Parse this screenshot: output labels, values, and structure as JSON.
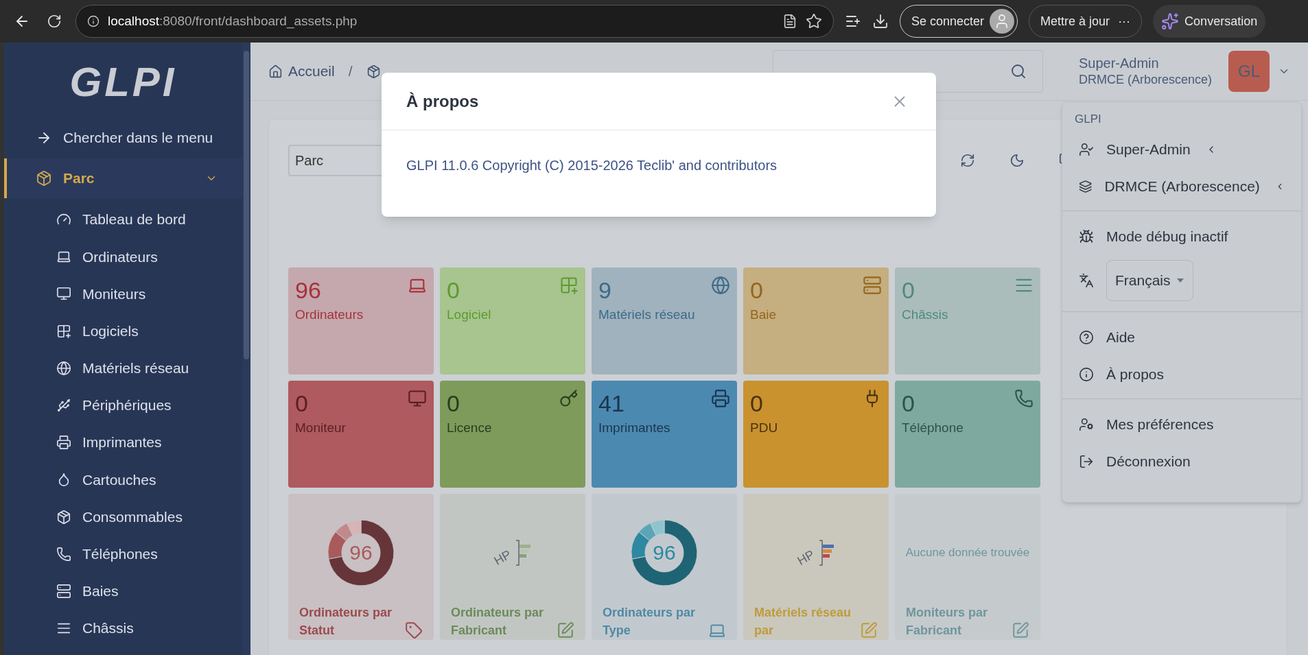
{
  "browser": {
    "url_host": "localhost",
    "url_rest": ":8080/front/dashboard_assets.php",
    "sign_in": "Se connecter",
    "update": "Mettre à jour",
    "more": "···",
    "copilot": "Conversation"
  },
  "sidebar": {
    "logo": "GLPI",
    "search_menu": "Chercher dans le menu",
    "section": {
      "label": "Parc",
      "expanded": true
    },
    "items": [
      {
        "label": "Tableau de bord"
      },
      {
        "label": "Ordinateurs"
      },
      {
        "label": "Moniteurs"
      },
      {
        "label": "Logiciels"
      },
      {
        "label": "Matériels réseau"
      },
      {
        "label": "Périphériques"
      },
      {
        "label": "Imprimantes"
      },
      {
        "label": "Cartouches"
      },
      {
        "label": "Consommables"
      },
      {
        "label": "Téléphones"
      },
      {
        "label": "Baies"
      },
      {
        "label": "Châssis"
      }
    ]
  },
  "header": {
    "breadcrumb": [
      {
        "label": "Accueil"
      },
      {
        "kind": "section"
      }
    ],
    "separator": "/",
    "user": {
      "name": "Super-Admin",
      "entity": "DRMCE (Arborescence)",
      "avatar": "GL"
    }
  },
  "dashboard": {
    "selector": "Parc",
    "cards": [
      {
        "value": "96",
        "label": "Ordinateurs",
        "color": "#c4a8ad"
      },
      {
        "value": "0",
        "label": "Logiciel",
        "color": "#a8c48f"
      },
      {
        "value": "9",
        "label": "Matériels réseau",
        "color": "#a0b2bd"
      },
      {
        "value": "0",
        "label": "Baie",
        "color": "#c5ae80"
      },
      {
        "value": "0",
        "label": "Châssis",
        "color": "#abbdba"
      },
      {
        "value": "0",
        "label": "Moniteur",
        "color": "#ae5a5e"
      },
      {
        "value": "0",
        "label": "Licence",
        "color": "#7e9b5c"
      },
      {
        "value": "41",
        "label": "Imprimantes",
        "color": "#4b89b0"
      },
      {
        "value": "0",
        "label": "PDU",
        "color": "#c9922f"
      },
      {
        "value": "0",
        "label": "Téléphone",
        "color": "#7ea99f"
      }
    ],
    "charts": [
      {
        "kind": "donut",
        "center": "96",
        "title": "Ordinateurs par Statut",
        "color": "#c9c0c3"
      },
      {
        "kind": "bars",
        "axis_label": "HP",
        "title": "Ordinateurs par Fabricant",
        "color": "#c2c6c3"
      },
      {
        "kind": "donut",
        "center": "96",
        "title": "Ordinateurs par Type",
        "color": "#c2c9ce"
      },
      {
        "kind": "bars",
        "axis_label": "HP",
        "title": "Matériels réseau par",
        "color": "#cac8bd"
      },
      {
        "kind": "empty",
        "message": "Aucune donnée trouvée",
        "title": "Moniteurs par Fabricant",
        "color": "#c5cacd"
      }
    ]
  },
  "modal": {
    "title": "À propos",
    "body": "GLPI 11.0.6 Copyright (C) 2015-2026 Teclib' and contributors"
  },
  "user_menu": {
    "heading": "GLPI",
    "sections": [
      [
        {
          "kind": "profile",
          "label": "Super-Admin"
        },
        {
          "kind": "entity",
          "label": "DRMCE (Arborescence)"
        }
      ],
      [
        {
          "kind": "debug",
          "label": "Mode débug inactif"
        },
        {
          "kind": "language",
          "label": "Français"
        }
      ],
      [
        {
          "kind": "help",
          "label": "Aide"
        },
        {
          "kind": "about",
          "label": "À propos"
        }
      ],
      [
        {
          "kind": "preferences",
          "label": "Mes préférences"
        },
        {
          "kind": "logout",
          "label": "Déconnexion"
        }
      ]
    ]
  }
}
